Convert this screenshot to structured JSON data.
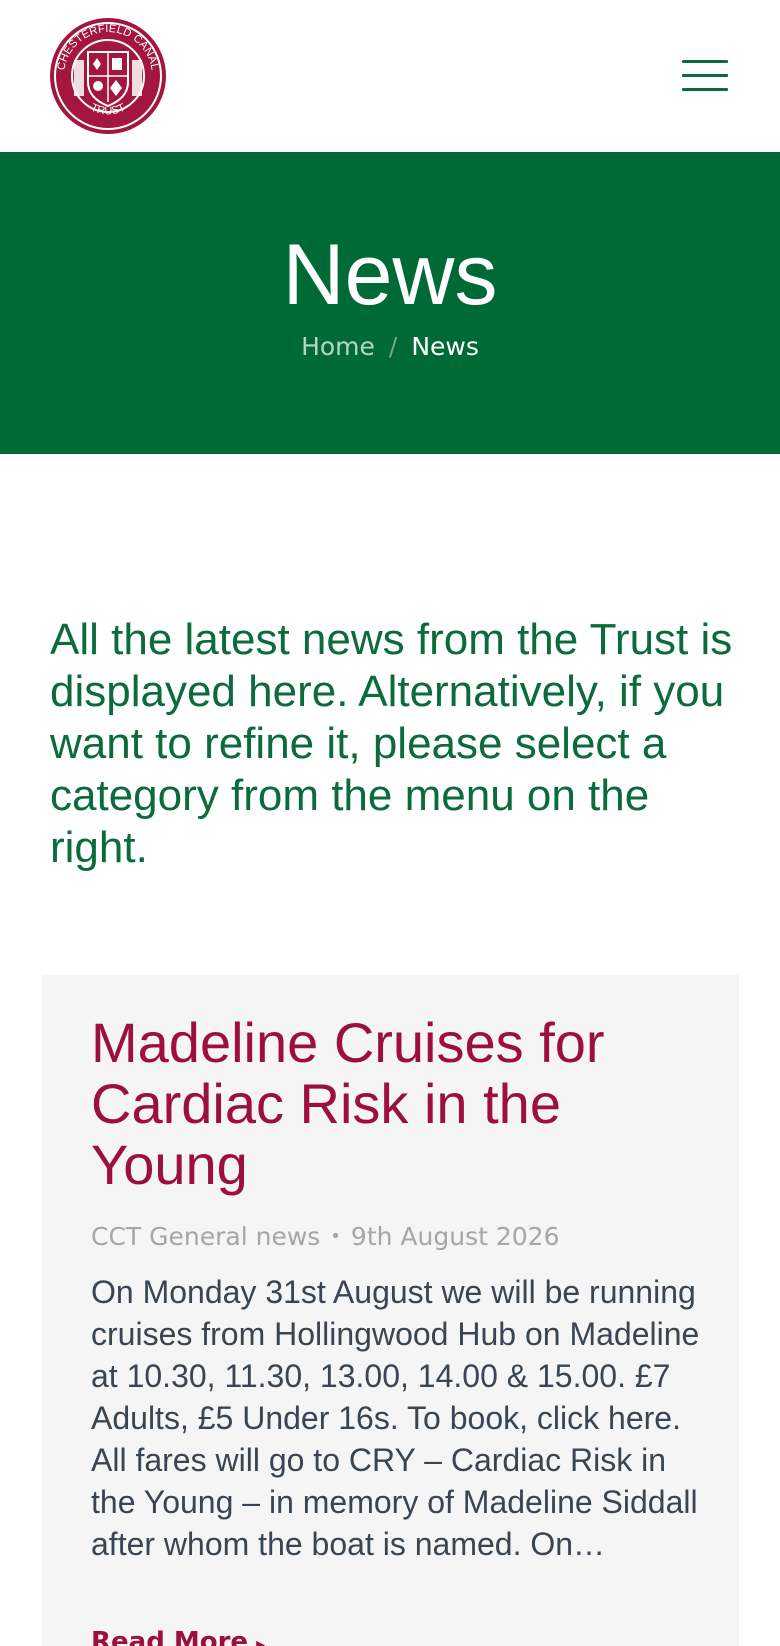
{
  "header": {
    "logo_text": "CHESTERFIELD CANAL TRUST",
    "menu_icon": "hamburger-menu-icon"
  },
  "banner": {
    "title": "News",
    "breadcrumb": {
      "home": "Home",
      "separator": "/",
      "current": "News"
    }
  },
  "intro": {
    "text": "All the latest news from the Trust is displayed here. Alternatively, if you want to refine it, please select a category from the menu on the right."
  },
  "posts": [
    {
      "title": "Madeline Cruises for Cardiac Risk in the Young",
      "category": "CCT General news",
      "date": "9th August 2026",
      "excerpt": "On Monday 31st August we will be running cruises from Hollingwood Hub on Madeline at 10.30, 11.30, 13.00, 14.00 & 15.00. £7 Adults, £5 Under 16s. To book, click here. All fares will go to CRY – Cardiac Risk in the Young – in memory of Madeline Siddall after whom the boat is named. On…",
      "read_more": "Read More"
    }
  ],
  "colors": {
    "brand_green": "#006a37",
    "brand_maroon": "#9c0f3e",
    "card_bg": "#f5f5f5"
  }
}
